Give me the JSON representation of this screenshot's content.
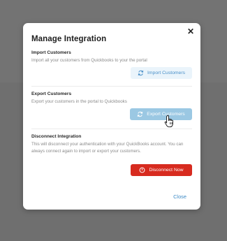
{
  "modal": {
    "title": "Manage Integration",
    "close_icon": "close-icon"
  },
  "import": {
    "heading": "Import Customers",
    "description": "Import all your customers from Quickbooks to your the portal",
    "button_label": "Import Customers",
    "button_icon": "sync-icon"
  },
  "export": {
    "heading": "Export Customers",
    "description": "Export your customers in the portal to Quickbooks",
    "button_label": "Export Customers",
    "button_icon": "sync-icon"
  },
  "disconnect": {
    "heading": "Disconnect Integration",
    "description": "This will disconnect your authentication with your QuickBooks account. You can always connect again to import or export your customers.",
    "button_label": "Disconnect Now",
    "button_icon": "power-icon"
  },
  "footer": {
    "close_label": "Close"
  },
  "colors": {
    "accent": "#3d8ac6",
    "danger": "#d72b1f",
    "overlay": "#6f6f6f"
  }
}
